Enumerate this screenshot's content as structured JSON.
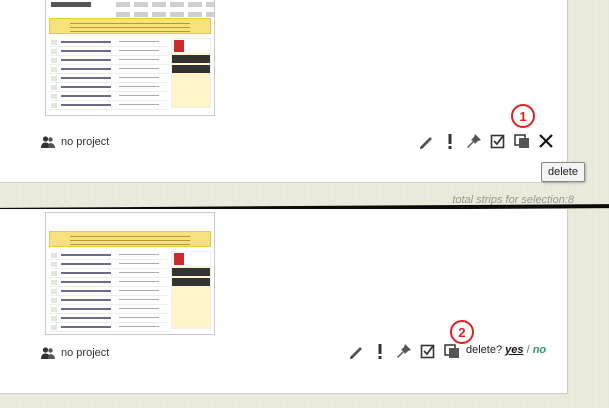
{
  "strip_top": {
    "project_label": "no project",
    "callout_number": "1",
    "tooltip": "delete",
    "icons": [
      "pencil-icon",
      "exclamation-icon",
      "pin-icon",
      "checkbox-icon",
      "copy-icon",
      "close-x-icon"
    ]
  },
  "total_top": "total strips for selection:8",
  "strip_bottom": {
    "project_label": "no project",
    "callout_number": "2",
    "confirm": {
      "question": "delete?",
      "yes": "yes",
      "separator": "/",
      "no": "no"
    },
    "icons": [
      "pencil-icon",
      "exclamation-icon",
      "pin-icon",
      "checkbox-icon",
      "copy-icon"
    ]
  },
  "colors": {
    "callout": "#e02020",
    "no_link": "#2a9a6a",
    "background": "#e9e8db"
  }
}
